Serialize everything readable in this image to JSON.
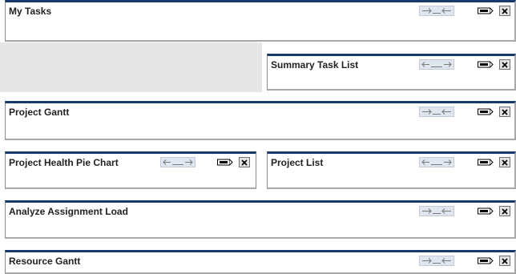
{
  "portlets": [
    {
      "title": "My Tasks",
      "resize_icon": "collapse-arrows-icon"
    },
    {
      "title": "Summary Task List",
      "resize_icon": "expand-arrows-icon"
    },
    {
      "title": "Project Gantt",
      "resize_icon": "collapse-arrows-icon"
    },
    {
      "title": "Project Health Pie Chart",
      "resize_icon": "expand-arrows-icon"
    },
    {
      "title": "Project List",
      "resize_icon": "expand-arrows-icon"
    },
    {
      "title": "Analyze Assignment Load",
      "resize_icon": "collapse-arrows-icon"
    },
    {
      "title": "Resource Gantt",
      "resize_icon": "collapse-arrows-icon"
    }
  ],
  "colors": {
    "header_border": "#173a6b",
    "resize_button_bg": "#dfe6ef",
    "empty_area_bg": "#e6e6e6"
  }
}
